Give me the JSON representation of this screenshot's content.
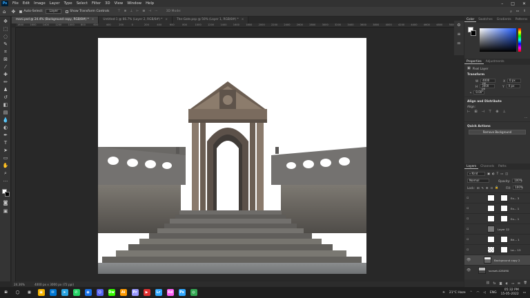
{
  "menu": {
    "logo": "Ps",
    "items": [
      "File",
      "Edit",
      "Image",
      "Layer",
      "Type",
      "Select",
      "Filter",
      "3D",
      "View",
      "Window",
      "Help"
    ],
    "window_controls": [
      "–",
      "□",
      "✕"
    ]
  },
  "options": {
    "auto_select_label": "Auto-Select:",
    "auto_select_target": "Layer",
    "show_transform_label": "Show Transform Controls",
    "mode_3d_label": "3D Mode:"
  },
  "tabs": [
    {
      "label": "mani.psd @ 24.4% (Background copy, RGB/8#) *",
      "active": true
    },
    {
      "label": "Untitled-1 @ 66.7% (Layer 2, RGB/8#) *",
      "active": false
    },
    {
      "label": "The-Gate.psp @ 50% (Layer 1, RGB/8#) *",
      "active": false
    }
  ],
  "ruler_ticks": [
    "1800",
    "1600",
    "1400",
    "1200",
    "1000",
    "800",
    "600",
    "400",
    "200",
    "0",
    "200",
    "400",
    "600",
    "800",
    "1000",
    "1200",
    "1400",
    "1600",
    "1800",
    "2000",
    "2200",
    "2400",
    "2600",
    "2800",
    "3000",
    "3200",
    "3400",
    "3600",
    "3800",
    "4000",
    "4200",
    "4400",
    "4600",
    "4800",
    "5000"
  ],
  "status": {
    "zoom": "24.36%",
    "doc_size": "4000 px x 3000 px (72 ppi)"
  },
  "panels": {
    "color_tabs": [
      "Color",
      "Swatches",
      "Gradients",
      "Patterns"
    ],
    "properties_tabs": [
      "Properties",
      "Adjustments"
    ],
    "pixel_layer_label": "Pixel Layer",
    "transform_title": "Transform",
    "w_label": "W",
    "w_value": "4000 px",
    "h_label": "H",
    "h_value": "3000 px",
    "x_label": "X",
    "x_value": "0 px",
    "y_label": "Y",
    "y_value": "0 px",
    "angle_value": "0.00°",
    "align_title": "Align and Distribute",
    "align_label": "Align:",
    "quick_title": "Quick Actions",
    "remove_bg": "Remove Background",
    "layers_tabs": [
      "Layers",
      "Channels",
      "Paths"
    ],
    "kind_label": "Kind",
    "blend_mode": "Normal",
    "opacity_label": "Opacity:",
    "opacity_value": "100%",
    "lock_label": "Lock:",
    "fill_label": "Fill:",
    "fill_value": "100%"
  },
  "layers": [
    {
      "name": "Ex... 3",
      "thumb": "white",
      "mask": true,
      "visible": false,
      "selected": false
    },
    {
      "name": "Ex... 1",
      "thumb": "white",
      "mask": true,
      "visible": false,
      "selected": false
    },
    {
      "name": "Ex... 1",
      "thumb": "white",
      "mask": true,
      "visible": false,
      "selected": false
    },
    {
      "name": "Layer 12",
      "thumb": "gray",
      "mask": false,
      "visible": false,
      "selected": false
    },
    {
      "name": "Bri... 1",
      "thumb": "white",
      "mask": true,
      "visible": false,
      "selected": false
    },
    {
      "name": "La... 13",
      "thumb": "chk",
      "mask": true,
      "visible": false,
      "selected": false
    },
    {
      "name": "Background copy 2",
      "thumb": "photo",
      "mask": false,
      "visible": true,
      "selected": true
    },
    {
      "name": "sunset-428490",
      "thumb": "photo",
      "mask": false,
      "visible": true,
      "selected": false
    }
  ],
  "taskbar": {
    "weather": "21°C Haze",
    "lang": "ENG",
    "time": "05:32 PM",
    "date": "15-05-2022",
    "apps": [
      {
        "label": "⊞",
        "color": "#1f1f1f"
      },
      {
        "label": "◯",
        "color": "#1f1f1f"
      },
      {
        "label": "▦",
        "color": "#1f1f1f"
      },
      {
        "label": "▣",
        "color": "#f5b400"
      },
      {
        "label": "✉",
        "color": "#0078d4"
      },
      {
        "label": "➤",
        "color": "#2aa3e0"
      },
      {
        "label": "✆",
        "color": "#25d366"
      },
      {
        "label": "◉",
        "color": "#1a73e8"
      },
      {
        "label": "☺",
        "color": "#5865f2"
      },
      {
        "label": "Dw",
        "color": "#35fa00"
      },
      {
        "label": "Ai",
        "color": "#ff9a00"
      },
      {
        "label": "Pr",
        "color": "#9999ff"
      },
      {
        "label": "▶",
        "color": "#e03131"
      },
      {
        "label": "Lr",
        "color": "#31a8ff"
      },
      {
        "label": "Xd",
        "color": "#ff61f6"
      },
      {
        "label": "Ps",
        "color": "#31a8ff"
      },
      {
        "label": "◎",
        "color": "#34a853"
      }
    ]
  }
}
